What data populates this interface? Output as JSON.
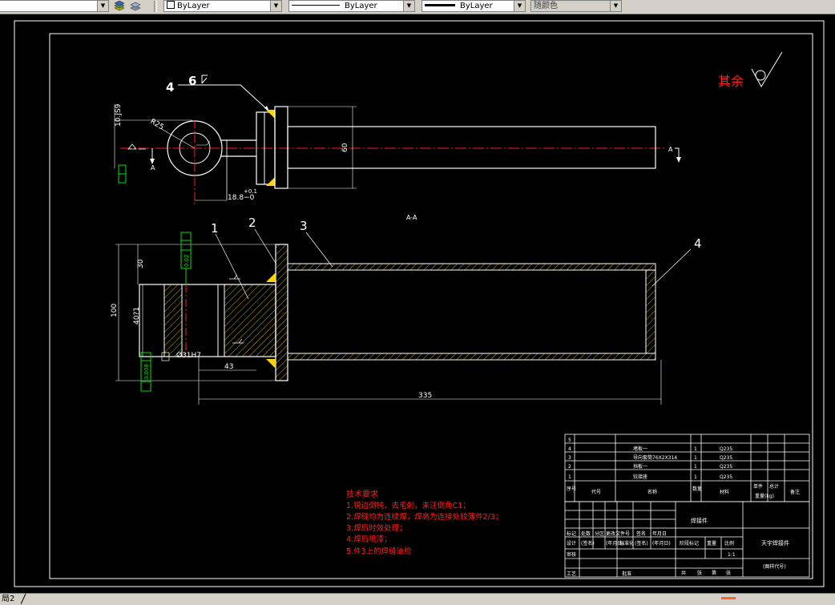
{
  "toolbar": {
    "color_control": "ByLayer",
    "linetype_control": "ByLayer",
    "lineweight_control": "ByLayer",
    "plotstyle_control": "随颜色"
  },
  "drawing": {
    "roughness_note": "其余",
    "weld_label_left": "4",
    "weld_label_right": "6",
    "dim_1052": "10.JS9",
    "dim_r25": "R25",
    "dim_188": "18.8−0",
    "dim_188_tol": "+0.1",
    "dim_60": "60",
    "section_mark": "A",
    "section_title": "A-A",
    "balloons": [
      "1",
      "2",
      "3",
      "4"
    ],
    "dim_30": "30",
    "dim_100": "100",
    "dim_40": "40?1",
    "dim_31h7": "Ø31H7",
    "dim_43": "43",
    "dim_335": "335",
    "tol_top": "0.02",
    "tol_bottom": "0.008"
  },
  "tech_requirements": {
    "title": "技术要求",
    "items": [
      "1.锐边倒钝，去毛刺，未注倒角C1；",
      "2.焊缝均为连续焊，焊高为连接处较薄件2/3；",
      "3.焊后时效处理；",
      "4.焊后喷漆；",
      "5.件3上的焊缝油检"
    ]
  },
  "bom": {
    "rows": [
      {
        "no": "5",
        "code": "",
        "name": "",
        "qty": "",
        "material": ""
      },
      {
        "no": "4",
        "code": "",
        "name": "堵板一",
        "qty": "1",
        "material": "Q235"
      },
      {
        "no": "3",
        "code": "",
        "name": "导向套筒76X2X314",
        "qty": "1",
        "material": "Q235"
      },
      {
        "no": "2",
        "code": "",
        "name": "挡板一",
        "qty": "1",
        "material": "Q235"
      },
      {
        "no": "1",
        "code": "",
        "name": "铰接座",
        "qty": "1",
        "material": "Q235"
      }
    ],
    "header": {
      "no": "序号",
      "code": "代号",
      "name": "名称",
      "qty": "数量",
      "material": "材料",
      "unit_weight": "单件",
      "total_weight": "总计",
      "weight_label": "重量(kg)",
      "remark": "备注"
    }
  },
  "title_block": {
    "part_name": "焊接件",
    "company": "天宇焊接件",
    "drawing_code": "(图样代号)",
    "scale": "1:1",
    "labels": [
      "标记",
      "处数",
      "分区",
      "更改文件号",
      "签名",
      "年月日",
      "设计",
      "(签名)",
      "(年月日)",
      "标准化",
      "(签名)",
      "(年月日)",
      "阶段标记",
      "重量",
      "比例",
      "审核",
      "工艺",
      "批准",
      "共",
      "张",
      "第",
      "张"
    ]
  },
  "layout_tabs": {
    "active_tab": "局2"
  }
}
